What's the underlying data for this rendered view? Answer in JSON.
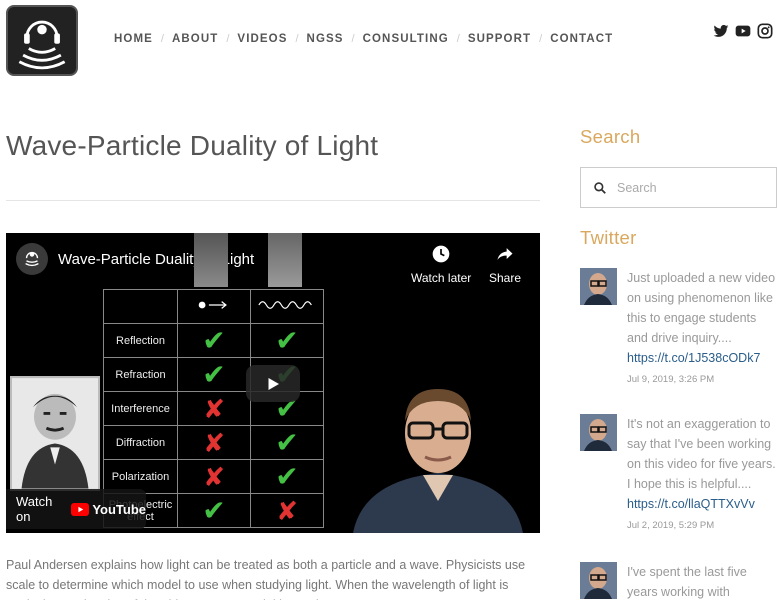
{
  "nav": {
    "items": [
      "HOME",
      "ABOUT",
      "VIDEOS",
      "NGSS",
      "CONSULTING",
      "SUPPORT",
      "CONTACT"
    ]
  },
  "social": [
    "twitter-icon",
    "youtube-icon",
    "instagram-icon"
  ],
  "page": {
    "title": "Wave-Particle Duality of Light",
    "description": "Paul Andersen explains how light can be treated as both a particle and a wave. Physicists use scale to determine which model to use when studying light. When the wavelength of light is equivalent to the size of the object a wave model is used."
  },
  "video": {
    "title": "Wave-Particle Duality of Light",
    "watch_later": "Watch later",
    "share": "Share",
    "watch_on": "Watch on",
    "youtube": "YouTube",
    "table_rows": [
      {
        "label": "Reflection",
        "particle": "check",
        "wave": "check"
      },
      {
        "label": "Refraction",
        "particle": "check",
        "wave": "check"
      },
      {
        "label": "Interference",
        "particle": "cross",
        "wave": "check"
      },
      {
        "label": "Diffraction",
        "particle": "cross",
        "wave": "check"
      },
      {
        "label": "Polarization",
        "particle": "cross",
        "wave": "check"
      },
      {
        "label": "Photoelectric effect",
        "particle": "check",
        "wave": "cross"
      }
    ]
  },
  "sidebar": {
    "search_heading": "Search",
    "search_placeholder": "Search",
    "twitter_heading": "Twitter",
    "tweets": [
      {
        "text": "Just uploaded a new video on using phenomenon like this to engage students and drive inquiry....",
        "link": "https://t.co/1J538cODk7",
        "date": "Jul 9, 2019, 3:26 PM"
      },
      {
        "text": "It's not an exaggeration to say that I've been working on this video for five years. I hope this is helpful....",
        "link": "https://t.co/llaQTTXvVv",
        "date": "Jul 2, 2019, 5:29 PM"
      },
      {
        "text": "I've spent the last five years working with",
        "link": "",
        "date": ""
      }
    ]
  }
}
